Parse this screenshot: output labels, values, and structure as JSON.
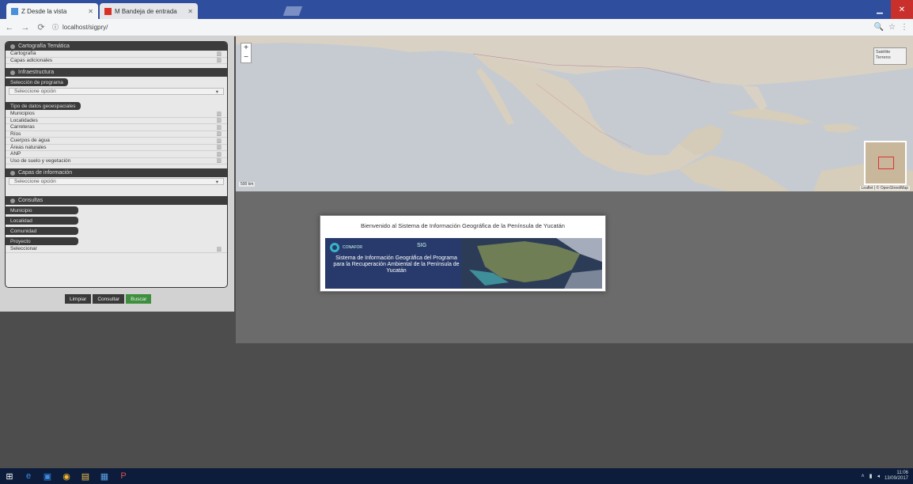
{
  "browser": {
    "tabs": [
      {
        "label": "Z Desde la vista",
        "favicon_color": "#4a90d9",
        "active": true
      },
      {
        "label": "M Bandeja de entrada",
        "favicon_color": "#d93025",
        "active": false
      }
    ],
    "url": "localhost/sigpry/",
    "window_controls": {
      "minimize": "▁",
      "close": "✕"
    },
    "nav": {
      "back": "←",
      "forward": "→",
      "reload": "⟳",
      "info": "ⓘ"
    },
    "addr_right": {
      "zoom": "🔍",
      "star": "☆",
      "menu": "⋮"
    }
  },
  "sidebar": {
    "section1": {
      "title": "Cartografía Temática",
      "rows": [
        "Cartografía",
        "Capas adicionales"
      ]
    },
    "section2": {
      "title": "Infraestructura",
      "pill": "Selección de programa",
      "select": "Seleccione opción"
    },
    "section3": {
      "pill": "Tipo de datos geoespaciales",
      "rows": [
        "Municipios",
        "Localidades",
        "Carreteras",
        "Ríos",
        "Cuerpos de agua",
        "Áreas naturales",
        "ANP",
        "Uso de suelo y vegetación"
      ]
    },
    "section4": {
      "title": "Capas de información",
      "select": "Seleccione opción"
    },
    "section5": {
      "title": "Consultas",
      "pills": [
        "Municipio",
        "Localidad",
        "Comunidad",
        "Proyecto"
      ],
      "last_row": "Seleccionar"
    },
    "buttons": {
      "clear": "Limpiar",
      "query": "Consultar",
      "search": "Buscar"
    }
  },
  "map": {
    "zoom_in": "+",
    "zoom_out": "−",
    "layer_control": [
      "Satélite",
      "Terreno"
    ],
    "credit": "Leaflet | © OpenStreetMap",
    "scale": "500 km"
  },
  "modal": {
    "title": "Bienvenido al Sistema de Información Geográfica de la Península de Yucatán",
    "banner_text": "Sistema de Información Geográfica del Programa para la Recuperación Ambiental de la Península de Yucatán",
    "logo_left": "CONAFOR",
    "logo_right": "SIG"
  },
  "taskbar": {
    "icons": [
      {
        "name": "windows-start-icon",
        "glyph": "⊞",
        "color": "#ffffff"
      },
      {
        "name": "edge-icon",
        "glyph": "e",
        "color": "#3a8ee6"
      },
      {
        "name": "store-icon",
        "glyph": "▣",
        "color": "#3a8ee6"
      },
      {
        "name": "chrome-icon",
        "glyph": "◉",
        "color": "#f2b72c"
      },
      {
        "name": "explorer-icon",
        "glyph": "▤",
        "color": "#f0c048"
      },
      {
        "name": "app-icon",
        "glyph": "▦",
        "color": "#5aa0e6"
      },
      {
        "name": "powerpoint-icon",
        "glyph": "P",
        "color": "#d9534f"
      }
    ],
    "clock_time": "11:06",
    "clock_date": "13/09/2017"
  }
}
